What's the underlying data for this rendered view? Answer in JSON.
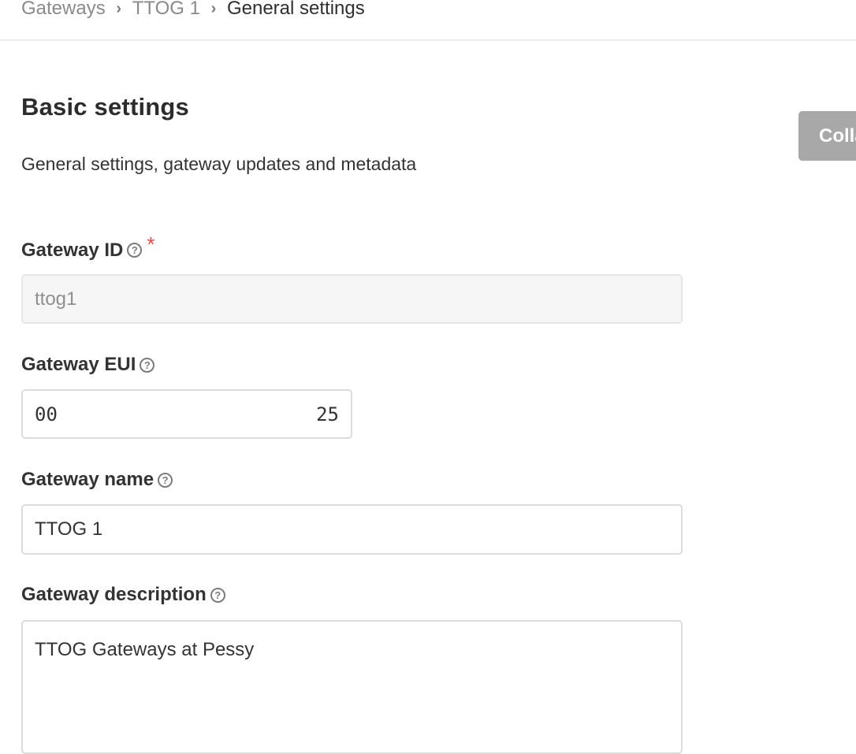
{
  "breadcrumbs": [
    {
      "label": "Gateways"
    },
    {
      "label": "TTOG 1"
    },
    {
      "label": "General settings"
    }
  ],
  "breadcrumb_separator": "›",
  "section": {
    "title": "Basic settings",
    "description": "General settings, gateway updates and metadata",
    "collapse_label": "Collapse"
  },
  "fields": {
    "gateway_id": {
      "label": "Gateway ID",
      "required_mark": "*",
      "value": "ttog1",
      "disabled": true
    },
    "gateway_eui": {
      "label": "Gateway EUI",
      "value_start": "00",
      "value_end": "25",
      "note": "middle bytes redacted"
    },
    "gateway_name": {
      "label": "Gateway name",
      "value": "TTOG 1"
    },
    "gateway_description": {
      "label": "Gateway description",
      "value": "TTOG Gateways at Pessy"
    }
  },
  "icons": {
    "help": "?",
    "help_icon_name": "question-circle-icon"
  },
  "colors": {
    "required": "#e24a4a",
    "button_disabled": "#a8a8a8",
    "input_border": "#dcdcdc",
    "disabled_bg": "#f6f6f6"
  }
}
